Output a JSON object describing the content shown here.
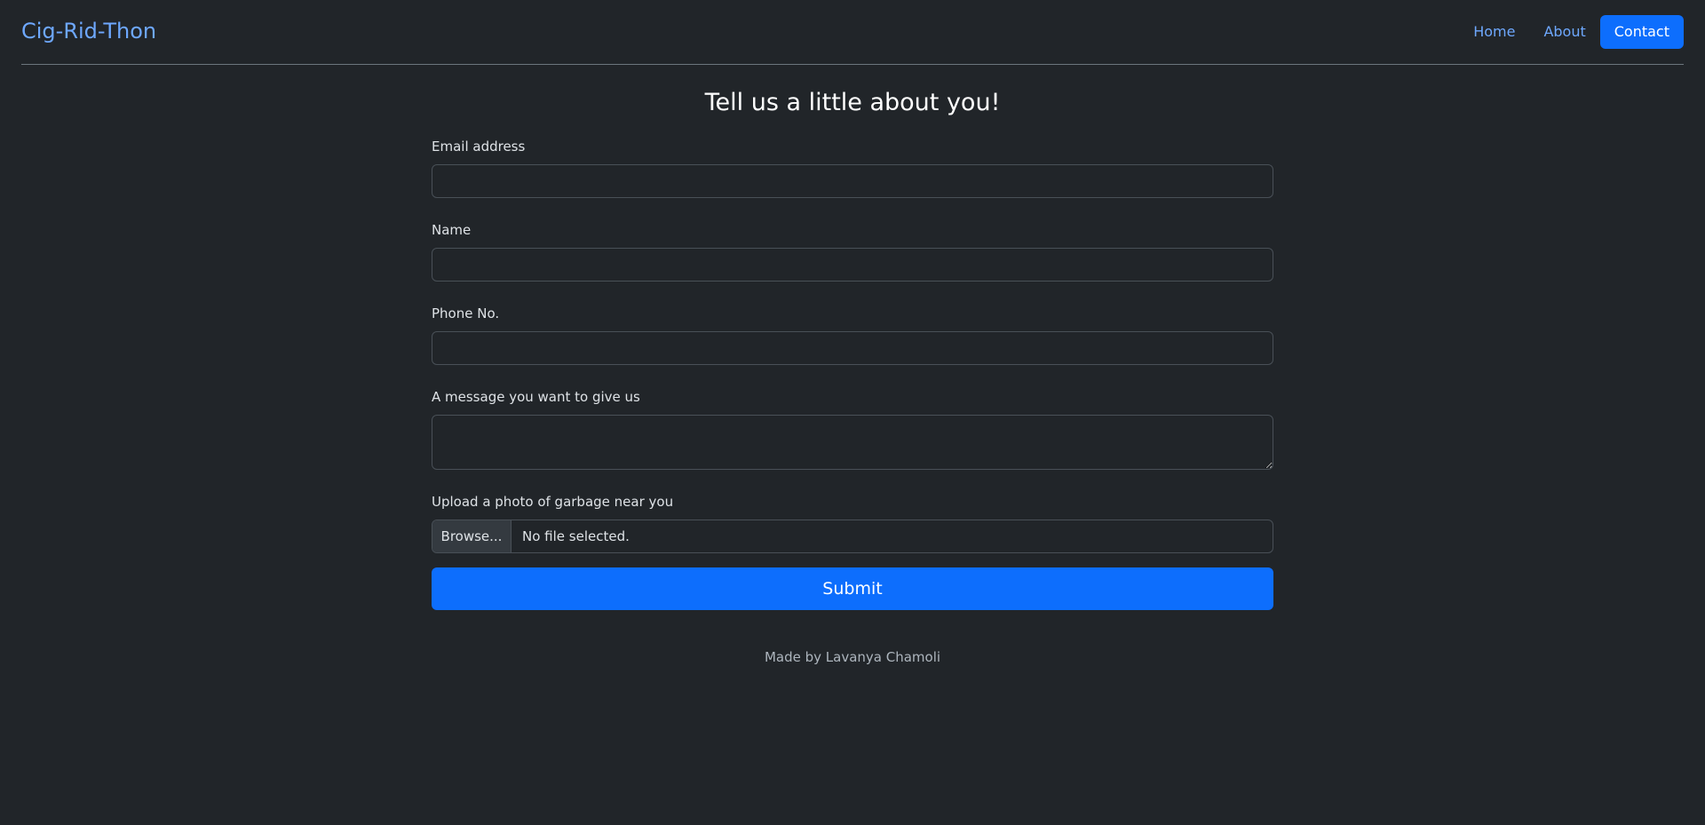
{
  "header": {
    "brand": "Cig-Rid-Thon",
    "nav": [
      {
        "label": "Home"
      },
      {
        "label": "About"
      },
      {
        "label": "Contact"
      }
    ]
  },
  "form": {
    "title": "Tell us a little about you!",
    "email_label": "Email address",
    "email_value": "",
    "name_label": "Name",
    "name_value": "",
    "phone_label": "Phone No.",
    "phone_value": "",
    "message_label": "A message you want to give us",
    "message_value": "",
    "upload_label": "Upload a photo of garbage near you",
    "browse_label": "Browse...",
    "file_status": "No file selected.",
    "submit_label": "Submit"
  },
  "footer": {
    "credit": "Made by Lavanya Chamoli"
  },
  "colors": {
    "background": "#212529",
    "accent": "#0d6efd",
    "link": "#6ea8fe"
  }
}
